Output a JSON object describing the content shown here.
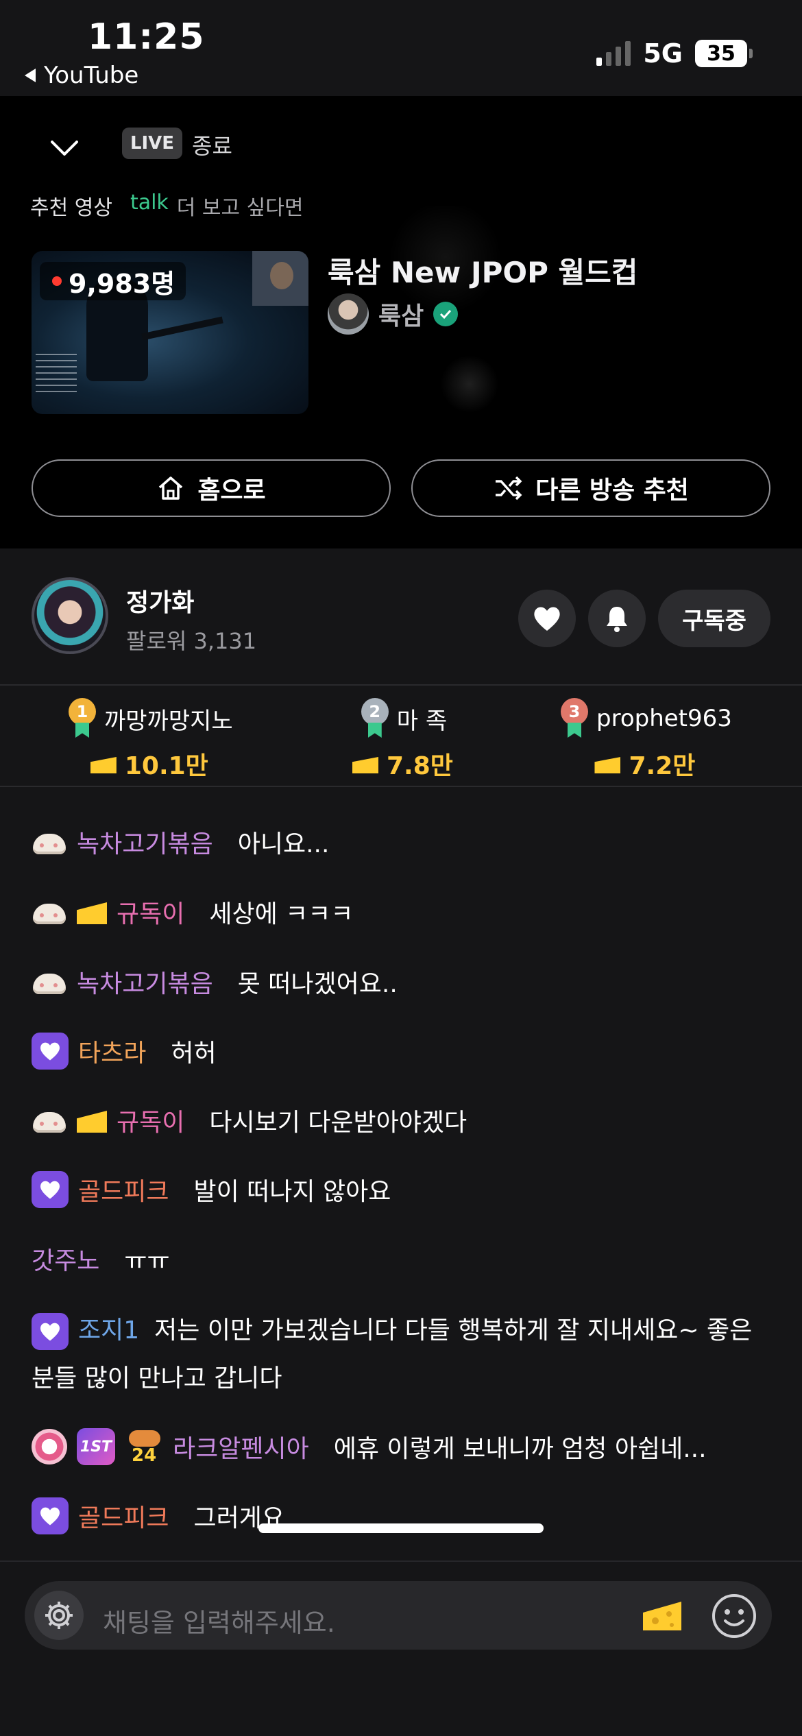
{
  "status_bar": {
    "time": "11:25",
    "back_app": "YouTube",
    "network": "5G",
    "battery": "35"
  },
  "live_panel": {
    "live_badge": "LIVE",
    "live_status": "종료",
    "recommend_label": "추천 영상",
    "talk_label": "talk",
    "talk_tail": "더 보고 싶다면",
    "viewer_count": "9,983명",
    "stream_title": "룩삼 New JPOP 월드컵",
    "streamer_name": "룩삼",
    "home_button": "홈으로",
    "other_button": "다른 방송 추천"
  },
  "channel": {
    "name": "정가화",
    "followers": "팔로워 3,131",
    "subscribe_label": "구독중"
  },
  "ranking": [
    {
      "rank": "1",
      "name": "까망까망지노",
      "amount": "10.1만",
      "color": "#f2b33a"
    },
    {
      "rank": "2",
      "name": "마 족",
      "amount": "7.8만",
      "color": "#a9b2bb"
    },
    {
      "rank": "3",
      "name": "prophet963",
      "amount": "7.2만",
      "color": "#e0786a"
    }
  ],
  "chat": [
    {
      "nick": "녹차고기볶음",
      "text": "아니요..."
    },
    {
      "nick": "규독이",
      "text": "세상에 ㅋㅋㅋ"
    },
    {
      "nick": "녹차고기볶음",
      "text": "못 떠나겠어요.."
    },
    {
      "nick": "타츠라",
      "text": "허허"
    },
    {
      "nick": "규독이",
      "text": "다시보기 다운받아야겠다"
    },
    {
      "nick": "골드피크",
      "text": "발이 떠나지 않아요"
    },
    {
      "nick": "갓주노",
      "text": "ㅠㅠ"
    },
    {
      "nick": "조지1",
      "text": "저는 이만 가보겠습니다 다들 행복하게 잘 지내세요~ 좋은 분들 많이 만나고 갑니다"
    },
    {
      "nick": "라크알펜시아",
      "text": "에휴 이렇게 보내니까 엄청 아쉽네...",
      "badge_text": "1ST",
      "badge_num": "24"
    },
    {
      "nick": "골드피크",
      "text": "그러게요"
    }
  ],
  "input": {
    "placeholder": "채팅을 입력해주세요."
  },
  "colors": {
    "background": "#151517",
    "panel": "#000000",
    "accent_green": "#3cc98e",
    "cheese": "#ffc83d"
  }
}
